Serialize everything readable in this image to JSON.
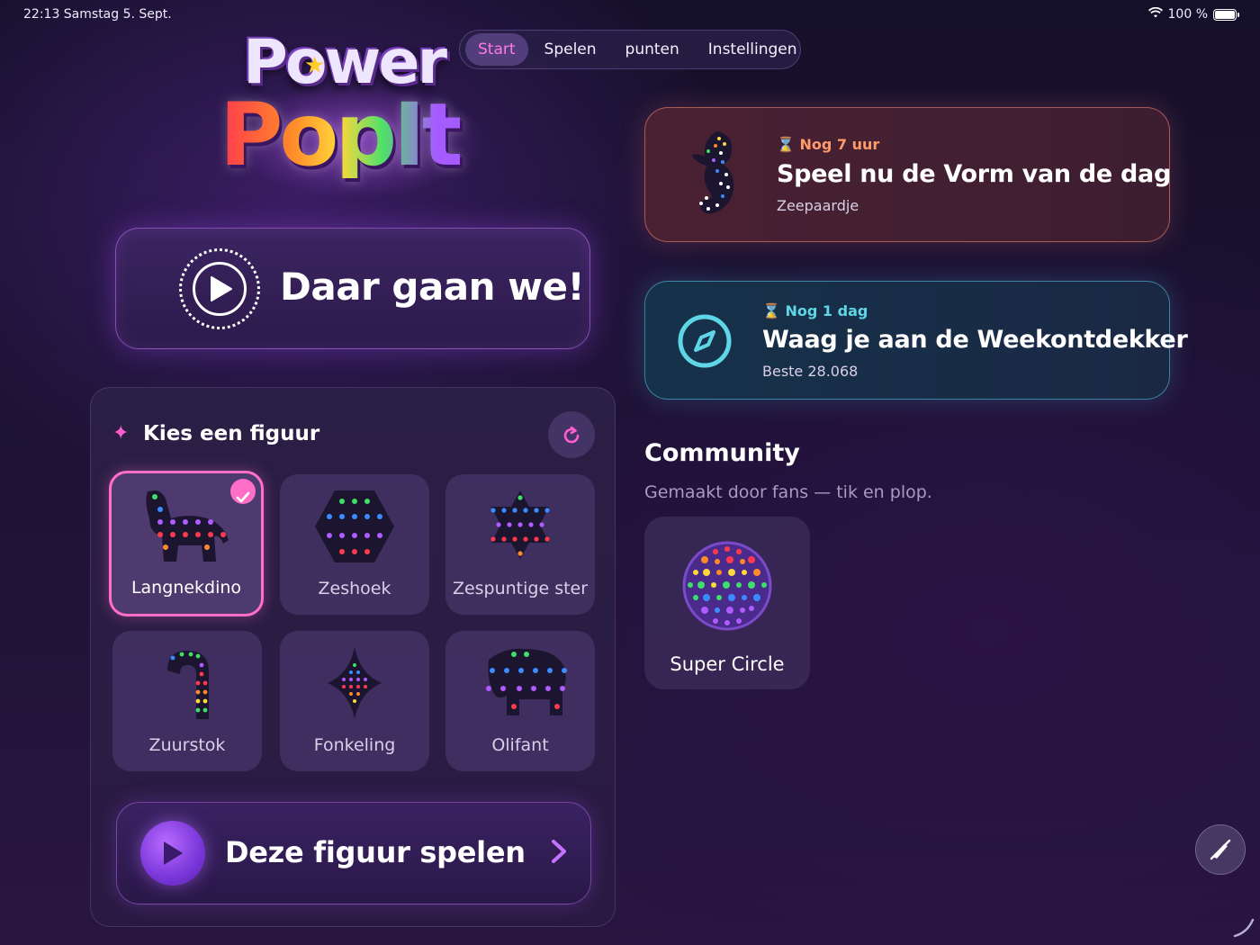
{
  "status_bar": {
    "time_date": "22:13  Samstag 5. Sept.",
    "battery": "100 %",
    "battery_level": 1.0
  },
  "logo": {
    "line1": "Power",
    "line2": "PopIt"
  },
  "nav": {
    "tabs": [
      {
        "label": "Start",
        "active": true
      },
      {
        "label": "Spelen",
        "active": false
      },
      {
        "label": "punten",
        "active": false
      },
      {
        "label": "Instellingen",
        "active": false
      }
    ]
  },
  "play_card": {
    "title": "Daar gaan we!"
  },
  "shape_picker": {
    "title": "Kies een figuur",
    "shapes": [
      {
        "label": "Langnekdino",
        "selected": true,
        "icon": "dino-shape-icon"
      },
      {
        "label": "Zeshoek",
        "selected": false,
        "icon": "hexagon-shape-icon"
      },
      {
        "label": "Zespuntige ster",
        "selected": false,
        "icon": "star-shape-icon"
      },
      {
        "label": "Zuurstok",
        "selected": false,
        "icon": "candy-cane-shape-icon"
      },
      {
        "label": "Fonkeling",
        "selected": false,
        "icon": "sparkle-shape-icon"
      },
      {
        "label": "Olifant",
        "selected": false,
        "icon": "elephant-shape-icon"
      }
    ],
    "play_button": "Deze figuur spelen"
  },
  "daily_event": {
    "timer": "Nog 7 uur",
    "title": "Speel nu de Vorm van de dag",
    "subtitle": "Zeepaardje",
    "accent": "#ff9a6a"
  },
  "weekly_event": {
    "timer": "Nog 1 dag",
    "title": "Waag je aan de Weekontdekker",
    "subtitle": "Beste 28.068",
    "accent": "#5fd6e6"
  },
  "community": {
    "title": "Community",
    "subtitle": "Gemaakt door fans — tik en plop.",
    "items": [
      {
        "label": "Super Circle"
      }
    ]
  }
}
